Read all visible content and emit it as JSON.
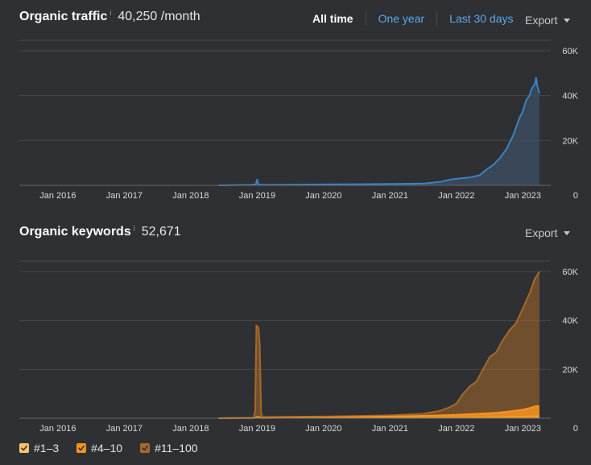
{
  "traffic": {
    "title": "Organic traffic",
    "info_mark": "i",
    "value": "40,250 /month",
    "range_tabs": [
      {
        "label": "All time",
        "active": true
      },
      {
        "label": "One year",
        "active": false
      },
      {
        "label": "Last 30 days",
        "active": false
      }
    ],
    "export_label": "Export"
  },
  "keywords": {
    "title": "Organic keywords",
    "info_mark": "i",
    "value": "52,671",
    "export_label": "Export"
  },
  "legend": [
    {
      "label": "#1–3",
      "color": "#f9c46b"
    },
    {
      "label": "#4–10",
      "color": "#f7931e"
    },
    {
      "label": "#11–100",
      "color": "#a5692a"
    }
  ],
  "colors": {
    "traffic_line": "#3b82c4",
    "traffic_fill": "#3b4a5c",
    "keywords_top3": "#f9c46b",
    "keywords_4_10": "#f7931e",
    "keywords_11_100": "#a5692a"
  },
  "chart_data": [
    {
      "type": "area",
      "title": "Organic traffic",
      "xlabel": "",
      "ylabel": "",
      "x_ticks": [
        "Jan 2016",
        "Jan 2017",
        "Jan 2018",
        "Jan 2019",
        "Jan 2020",
        "Jan 2021",
        "Jan 2022",
        "Jan 2023"
      ],
      "y_ticks": [
        "0",
        "20K",
        "40K",
        "60K"
      ],
      "xlim": [
        2015.42,
        2023.42
      ],
      "ylim": [
        0,
        60000
      ],
      "grid": true,
      "series": [
        {
          "x": [
            2018.42,
            2018.9,
            2018.98,
            2019.0,
            2019.02,
            2019.05,
            2019.1,
            2019.5,
            2020.0,
            2020.5,
            2021.0,
            2021.5,
            2021.75,
            2021.9,
            2022.0,
            2022.2,
            2022.35,
            2022.45,
            2022.5,
            2022.55,
            2022.65,
            2022.75,
            2022.85,
            2022.95,
            2023.0,
            2023.05,
            2023.1,
            2023.12,
            2023.15,
            2023.18,
            2023.2,
            2023.22,
            2023.25
          ],
          "y": [
            0,
            200,
            400,
            2600,
            400,
            300,
            200,
            300,
            400,
            500,
            600,
            800,
            1500,
            2500,
            3000,
            3500,
            4500,
            7000,
            8000,
            9000,
            12000,
            16000,
            22000,
            30000,
            33000,
            38000,
            40000,
            42000,
            44000,
            45000,
            48000,
            44000,
            41000
          ]
        }
      ]
    },
    {
      "type": "area",
      "title": "Organic keywords",
      "xlabel": "",
      "ylabel": "",
      "x_ticks": [
        "Jan 2016",
        "Jan 2017",
        "Jan 2018",
        "Jan 2019",
        "Jan 2020",
        "Jan 2021",
        "Jan 2022",
        "Jan 2023"
      ],
      "y_ticks": [
        "0",
        "20K",
        "40K",
        "60K"
      ],
      "xlim": [
        2015.42,
        2023.42
      ],
      "ylim": [
        0,
        60000
      ],
      "grid": true,
      "legend_position": "bottom-left",
      "series": [
        {
          "name": "#1–3",
          "x": [
            2018.42,
            2019.0,
            2020.0,
            2021.0,
            2022.0,
            2022.5,
            2023.0,
            2023.25
          ],
          "y": [
            0,
            50,
            100,
            150,
            300,
            500,
            800,
            1000
          ]
        },
        {
          "name": "#4–10",
          "x": [
            2018.42,
            2018.97,
            2018.99,
            2019.04,
            2019.06,
            2019.5,
            2020.0,
            2020.5,
            2021.0,
            2021.5,
            2022.0,
            2022.3,
            2022.6,
            2022.8,
            2023.0,
            2023.1,
            2023.2,
            2023.25
          ],
          "y": [
            0,
            100,
            500,
            500,
            100,
            200,
            300,
            500,
            700,
            1000,
            1400,
            1800,
            2200,
            2800,
            3500,
            4200,
            5000,
            4800
          ]
        },
        {
          "name": "#11–100",
          "x": [
            2018.42,
            2018.95,
            2018.97,
            2018.99,
            2019.02,
            2019.04,
            2019.06,
            2019.08,
            2019.5,
            2020.0,
            2020.5,
            2021.0,
            2021.5,
            2021.75,
            2021.9,
            2022.0,
            2022.1,
            2022.2,
            2022.3,
            2022.4,
            2022.5,
            2022.6,
            2022.7,
            2022.8,
            2022.9,
            2023.0,
            2023.1,
            2023.18,
            2023.25
          ],
          "y": [
            0,
            200,
            3000,
            38000,
            37000,
            30000,
            2000,
            500,
            600,
            700,
            900,
            1200,
            1800,
            3000,
            4500,
            6000,
            10000,
            13000,
            15000,
            20000,
            25000,
            27000,
            32000,
            36000,
            39000,
            45000,
            51000,
            57000,
            60000
          ]
        }
      ]
    }
  ]
}
